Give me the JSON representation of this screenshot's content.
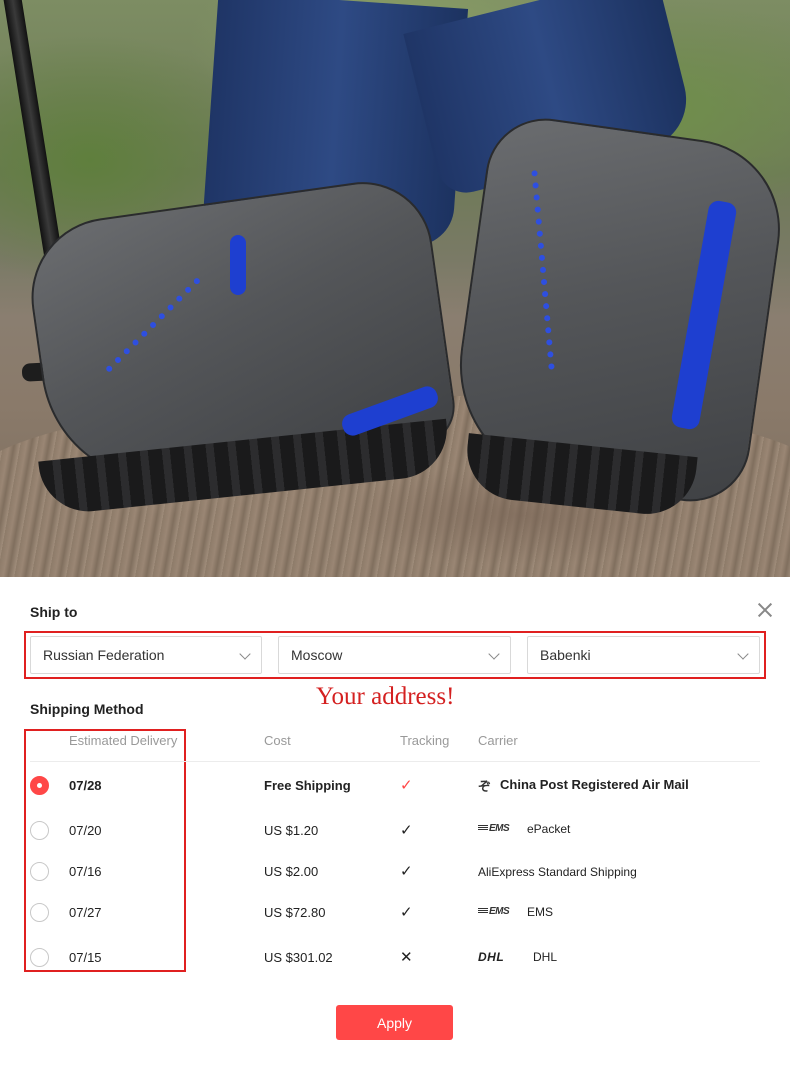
{
  "hero_image": {
    "description_icon": "hiking-boots-photo"
  },
  "ship_to": {
    "title": "Ship to",
    "country": "Russian Federation",
    "city": "Moscow",
    "district": "Babenki"
  },
  "annotation": "Your address!",
  "shipping_method": {
    "title": "Shipping Method",
    "columns": {
      "delivery": "Estimated Delivery",
      "cost": "Cost",
      "tracking": "Tracking",
      "carrier": "Carrier"
    },
    "options": [
      {
        "date": "07/28",
        "cost": "Free Shipping",
        "tracking": "yes",
        "carrier": "China Post Registered Air Mail",
        "carrier_logo": "china-post-logo",
        "selected": true
      },
      {
        "date": "07/20",
        "cost": "US $1.20",
        "tracking": "yes",
        "carrier": "ePacket",
        "carrier_logo": "ems-logo",
        "selected": false
      },
      {
        "date": "07/16",
        "cost": "US $2.00",
        "tracking": "yes",
        "carrier": "AliExpress Standard Shipping",
        "carrier_logo": "",
        "selected": false
      },
      {
        "date": "07/27",
        "cost": "US $72.80",
        "tracking": "yes",
        "carrier": "EMS",
        "carrier_logo": "ems-logo",
        "selected": false
      },
      {
        "date": "07/15",
        "cost": "US $301.02",
        "tracking": "no",
        "carrier": "DHL",
        "carrier_logo": "dhl-logo",
        "selected": false
      }
    ]
  },
  "logos": {
    "ems": "EMS",
    "dhl": "DHL"
  },
  "apply_label": "Apply",
  "colors": {
    "accent": "#ff4747",
    "annotation": "#d42020"
  }
}
